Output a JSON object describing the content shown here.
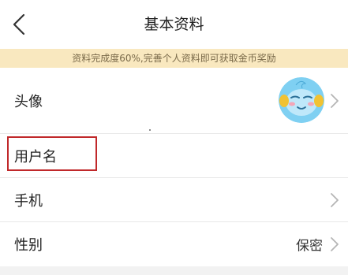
{
  "header": {
    "title": "基本资料",
    "back_icon": "chevron-left-icon"
  },
  "banner": {
    "text": "资料完成度60%,完善个人资料即可获取金币奖励"
  },
  "rows": [
    {
      "label": "头像",
      "value": "",
      "chevron": true
    },
    {
      "label": "用户名",
      "value": "",
      "chevron": false
    },
    {
      "label": "手机",
      "value": "",
      "chevron": true
    },
    {
      "label": "性别",
      "value": "保密",
      "chevron": true
    }
  ],
  "colors": {
    "banner_bg": "#f9e8bf",
    "banner_text": "#7a6a4a",
    "highlight": "#c0282a"
  }
}
